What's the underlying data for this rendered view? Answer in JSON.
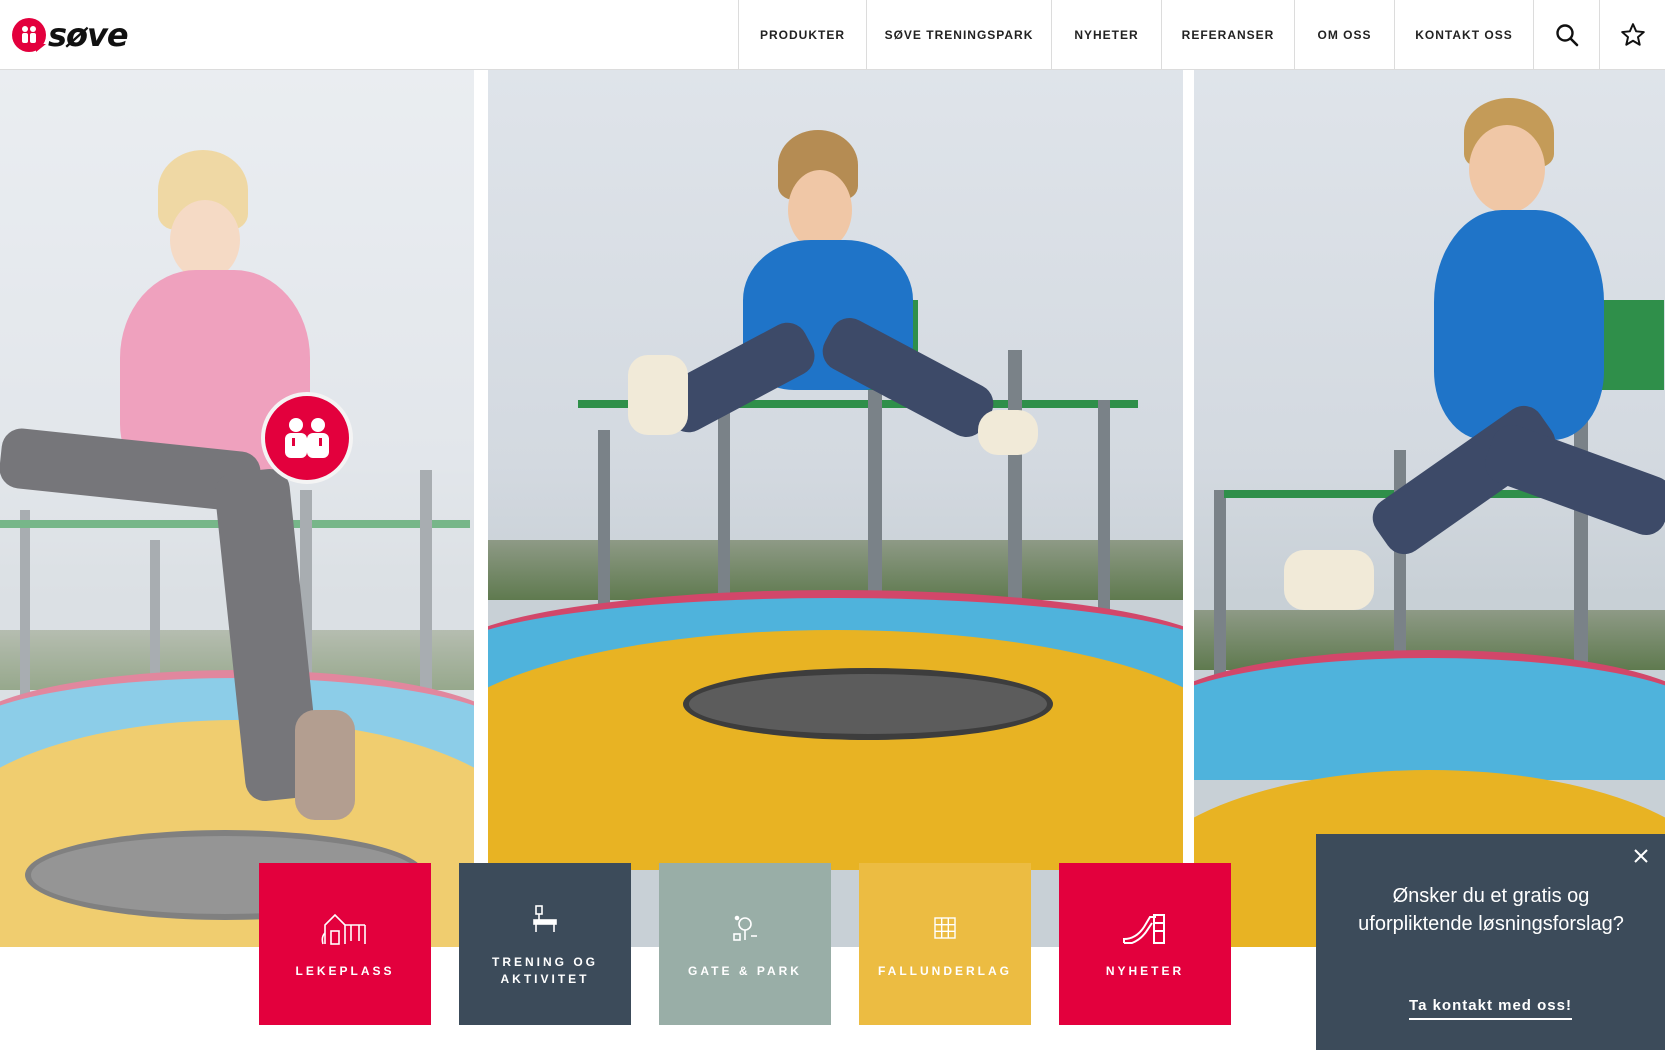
{
  "header": {
    "logo_text": "søve",
    "nav": [
      {
        "label": "PRODUKTER"
      },
      {
        "label": "SØVE TRENINGSPARK"
      },
      {
        "label": "NYHETER"
      },
      {
        "label": "REFERANSER"
      },
      {
        "label": "OM OSS"
      },
      {
        "label": "KONTAKT OSS"
      }
    ],
    "icons": [
      "search-icon",
      "star-icon"
    ]
  },
  "hero": {
    "photos": [
      "girl-jumping-photo",
      "boy-jumping-photo",
      "boy-running-photo"
    ],
    "badge_icon": "kids-icon"
  },
  "tiles": [
    {
      "label": "LEKEPLASS",
      "icon": "playhouse-icon",
      "color": "#e3003d"
    },
    {
      "label": "TRENING OG AKTIVITET",
      "icon": "fitness-bench-icon",
      "color": "#3c4b5a"
    },
    {
      "label": "GATE & PARK",
      "icon": "park-tree-icon",
      "color": "#99aea7"
    },
    {
      "label": "FALLUNDERLAG",
      "icon": "tiles-grid-icon",
      "color": "#ecbc42"
    },
    {
      "label": "NYHETER",
      "icon": "slide-icon",
      "color": "#e3003d"
    }
  ],
  "cta": {
    "question": "Ønsker du et gratis og uforpliktende løsningsforslag?",
    "link": "Ta kontakt med oss!",
    "close_icon": "close-icon",
    "background": "#3c4b5a"
  },
  "colors": {
    "brand_red": "#e3003d",
    "dark": "#3c4b5a"
  }
}
